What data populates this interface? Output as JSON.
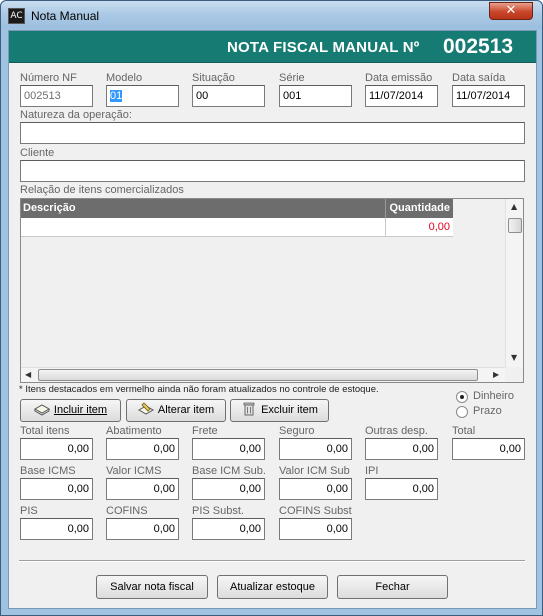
{
  "window": {
    "title": "Nota Manual",
    "icon_text": "AC",
    "close_glyph": "✕"
  },
  "header": {
    "label": "NOTA FISCAL MANUAL Nº",
    "number": "002513",
    "color": "#167b72"
  },
  "fields": {
    "numero_nf": {
      "label": "Número NF",
      "value": "002513"
    },
    "modelo": {
      "label": "Modelo",
      "value": "01"
    },
    "situacao": {
      "label": "Situação",
      "value": "00"
    },
    "serie": {
      "label": "Série",
      "value": "001"
    },
    "data_emissao": {
      "label": "Data emissão",
      "value": "11/07/2014"
    },
    "data_saida": {
      "label": "Data saída",
      "value": "11/07/2014"
    },
    "natureza": {
      "label": "Natureza da operação:",
      "value": ""
    },
    "cliente": {
      "label": "Cliente",
      "value": ""
    }
  },
  "items": {
    "label": "Relação de itens comercializados",
    "columns": [
      "Descrição",
      "Quantidade"
    ],
    "rows": [
      {
        "descricao": "",
        "quantidade": "0,00"
      }
    ]
  },
  "note": "* Itens destacados em vermelho ainda não foram atualizados no controle de estoque.",
  "item_buttons": {
    "incluir": "Incluir item",
    "alterar": "Alterar item",
    "excluir": "Excluir item"
  },
  "payment": {
    "dinheiro": "Dinheiro",
    "prazo": "Prazo",
    "selected": "dinheiro"
  },
  "totals": {
    "total_itens": {
      "label": "Total itens",
      "value": "0,00"
    },
    "abatimento": {
      "label": "Abatimento",
      "value": "0,00"
    },
    "frete": {
      "label": "Frete",
      "value": "0,00"
    },
    "seguro": {
      "label": "Seguro",
      "value": "0,00"
    },
    "outras_desp": {
      "label": "Outras desp.",
      "value": "0,00"
    },
    "total": {
      "label": "Total",
      "value": "0,00"
    },
    "base_icms": {
      "label": "Base ICMS",
      "value": "0,00"
    },
    "valor_icms": {
      "label": "Valor ICMS",
      "value": "0,00"
    },
    "base_icm_sub": {
      "label": "Base ICM Sub.",
      "value": "0,00"
    },
    "valor_icm_sub": {
      "label": "Valor ICM Sub",
      "value": "0,00"
    },
    "ipi": {
      "label": "IPI",
      "value": "0,00"
    },
    "pis": {
      "label": "PIS",
      "value": "0,00"
    },
    "cofins": {
      "label": "COFINS",
      "value": "0,00"
    },
    "pis_subst": {
      "label": "PIS Subst.",
      "value": "0,00"
    },
    "cofins_subst": {
      "label": "COFINS Subst",
      "value": "0,00"
    }
  },
  "footer_buttons": {
    "salvar": "Salvar nota fiscal",
    "atualizar": "Atualizar estoque",
    "fechar": "Fechar"
  }
}
